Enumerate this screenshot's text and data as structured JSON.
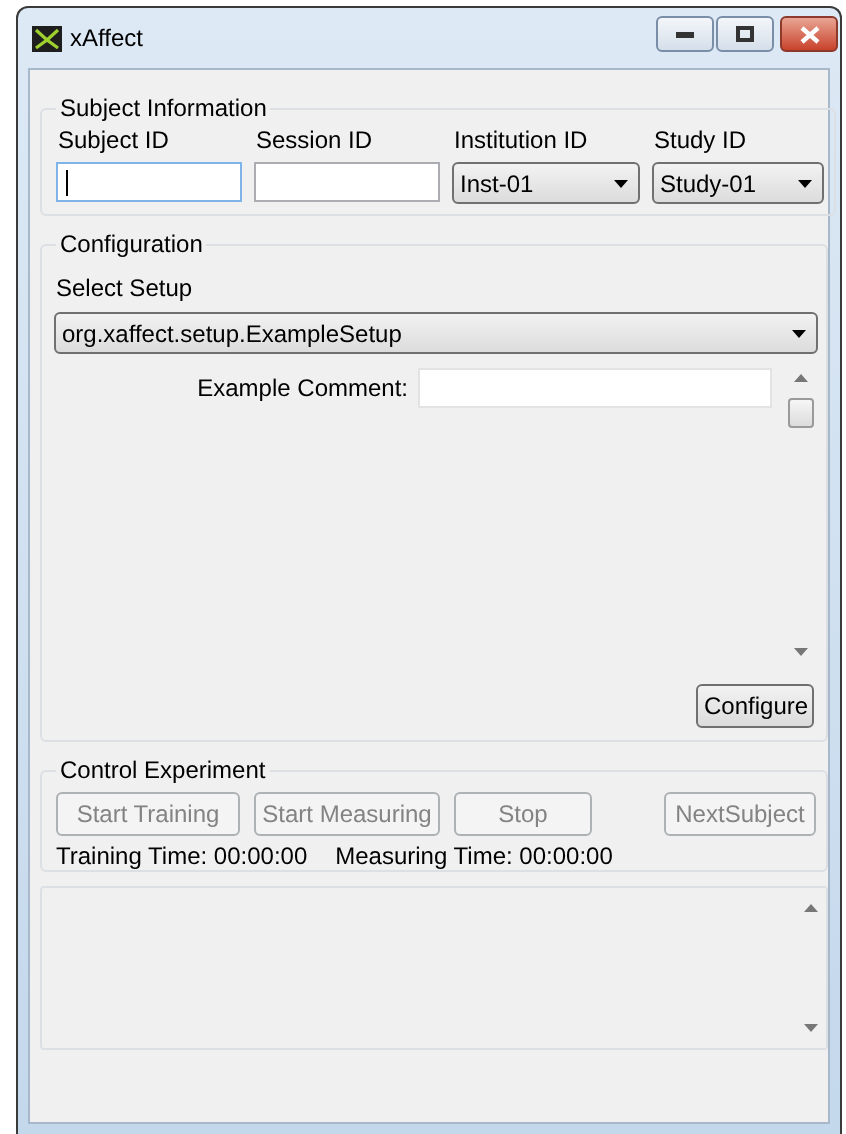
{
  "window": {
    "title": "xAffect"
  },
  "subject_information": {
    "title": "Subject Information",
    "fields": [
      {
        "label": "Subject ID",
        "kind": "text",
        "focused": true
      },
      {
        "label": "Session ID",
        "kind": "text",
        "focused": false
      },
      {
        "label": "Institution ID",
        "kind": "dropdown",
        "value": "Inst-01"
      },
      {
        "label": "Study ID",
        "kind": "dropdown",
        "value": "Study-01"
      }
    ]
  },
  "configuration": {
    "title": "Configuration",
    "select_label": "Select Setup",
    "setup": "org.xaffect.setup.ExampleSetup",
    "parameters": [
      {
        "label": "Example Comment:"
      }
    ],
    "button": "Configure"
  },
  "control_experiment": {
    "title": "Control Experiment",
    "buttons": [
      {
        "label": "Start Training",
        "disabled": true
      },
      {
        "label": "Start Measuring",
        "disabled": true
      },
      {
        "label": "Stop",
        "disabled": true
      },
      {
        "label": "NextSubject",
        "disabled": true
      }
    ],
    "times": [
      "Training Time: 00:00:00",
      "Measuring Time: 00:00:00"
    ]
  }
}
